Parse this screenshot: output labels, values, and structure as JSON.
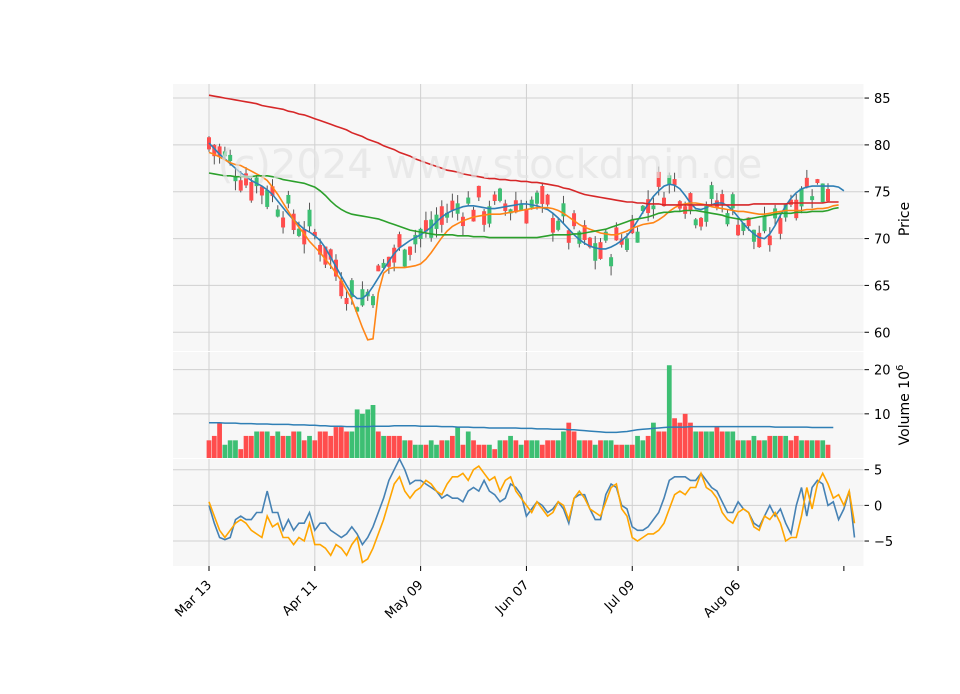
{
  "watermark": "(c)2024 www.stockdmin.de",
  "chart_data": [
    {
      "type": "candlestick",
      "panel": "price",
      "ylabel": "Price",
      "ylim": [
        58,
        86.5
      ],
      "yticks": [
        60,
        65,
        70,
        75,
        80,
        85
      ],
      "xtick_labels": [
        "Mar 13",
        "Apr 11",
        "May 09",
        "Jun 07",
        "Jul 09",
        "Aug 06"
      ],
      "xtick_index": [
        0,
        20,
        40,
        60,
        80,
        100
      ],
      "grid": true,
      "colors": {
        "up": "#3dbf73",
        "down": "#ff4d4d",
        "ma_blue": "#2f7fb5",
        "ma_orange": "#ff8516",
        "ma_green": "#2ca02c",
        "ma_red": "#d62728"
      },
      "moving_averages": [
        {
          "color": "ma_blue",
          "values": [
            80.2,
            79.6,
            79.0,
            78.5,
            78.0,
            77.5,
            77.0,
            76.6,
            76.2,
            75.9,
            75.6,
            75.2,
            74.7,
            74.0,
            73.3,
            72.6,
            72.0,
            71.5,
            71.0,
            70.7,
            70.3,
            69.8,
            69.0,
            68.0,
            67.0,
            66.0,
            65.0,
            64.1,
            63.6,
            63.6,
            64.1,
            64.9,
            65.8,
            66.7,
            67.6,
            68.4,
            69.0,
            69.4,
            69.8,
            70.1,
            70.4,
            70.8,
            71.2,
            71.8,
            72.3,
            72.7,
            73.0,
            73.2,
            73.4,
            73.5,
            73.5,
            73.4,
            73.3,
            73.2,
            73.2,
            73.3,
            73.4,
            73.5,
            73.6,
            73.7,
            73.7,
            73.6,
            73.5,
            73.3,
            73.1,
            72.7,
            72.2,
            71.6,
            71.0,
            70.4,
            69.9,
            69.5,
            69.2,
            69.0,
            68.9,
            68.9,
            69.1,
            69.4,
            69.8,
            70.3,
            71.0,
            71.9,
            72.8,
            73.7,
            74.5,
            75.1,
            75.6,
            75.8,
            75.7,
            75.3,
            74.6,
            73.8,
            73.2,
            73.1,
            73.3,
            73.6,
            73.8,
            73.8,
            73.5,
            73.0,
            72.3,
            71.6,
            71.0,
            70.5,
            70.1,
            70.0,
            70.5,
            71.4,
            72.5,
            73.5,
            74.3,
            74.9,
            75.3,
            75.5,
            75.6,
            75.6,
            75.6,
            75.6,
            75.6,
            75.5,
            75.1
          ]
        },
        {
          "color": "ma_orange",
          "values": [
            79.2,
            79.0,
            78.7,
            78.4,
            78.1,
            77.9,
            77.8,
            77.5,
            77.2,
            76.9,
            76.6,
            76.2,
            75.5,
            74.7,
            73.8,
            72.9,
            72.0,
            71.2,
            70.5,
            69.7,
            69.1,
            68.5,
            67.8,
            67.1,
            66.3,
            65.5,
            64.5,
            63.5,
            62.0,
            60.5,
            59.2,
            59.3,
            64.2,
            66.3,
            66.8,
            66.9,
            66.9,
            66.9,
            67.0,
            67.1,
            67.3,
            67.8,
            68.5,
            69.3,
            70.1,
            70.8,
            71.3,
            71.6,
            71.9,
            72.1,
            72.3,
            72.4,
            72.5,
            72.6,
            72.6,
            72.6,
            72.7,
            72.8,
            72.9,
            73.0,
            73.1,
            73.2,
            73.3,
            73.3,
            73.3,
            73.2,
            73.0,
            72.7,
            72.3,
            71.9,
            71.5,
            71.2,
            71.0,
            70.8,
            70.6,
            70.5,
            70.4,
            70.4,
            70.6,
            70.8,
            71.1,
            71.3,
            71.5,
            71.6,
            71.7,
            72.0,
            72.4,
            72.9,
            73.3,
            73.6,
            73.7,
            73.8,
            73.8,
            73.7,
            73.6,
            73.4,
            73.3,
            73.2,
            73.1,
            73.0,
            72.9,
            72.9,
            72.8,
            72.7,
            72.6,
            72.6,
            72.7,
            72.8,
            72.9,
            73.0,
            73.0,
            73.0,
            73.0,
            73.1,
            73.1,
            73.2,
            73.2,
            73.3,
            73.5,
            73.6
          ]
        },
        {
          "color": "ma_green",
          "values": [
            77.0,
            76.9,
            76.8,
            76.7,
            76.7,
            76.6,
            76.6,
            76.6,
            76.6,
            76.7,
            76.7,
            76.7,
            76.6,
            76.5,
            76.3,
            76.2,
            76.1,
            76.0,
            75.9,
            75.7,
            75.5,
            75.1,
            74.6,
            74.0,
            73.5,
            73.1,
            72.8,
            72.6,
            72.5,
            72.4,
            72.3,
            72.2,
            72.1,
            71.9,
            71.7,
            71.5,
            71.3,
            71.1,
            70.9,
            70.8,
            70.7,
            70.6,
            70.5,
            70.4,
            70.4,
            70.4,
            70.4,
            70.3,
            70.3,
            70.3,
            70.2,
            70.2,
            70.2,
            70.1,
            70.1,
            70.1,
            70.1,
            70.1,
            70.1,
            70.1,
            70.1,
            70.1,
            70.1,
            70.2,
            70.3,
            70.4,
            70.4,
            70.4,
            70.4,
            70.5,
            70.5,
            70.6,
            70.7,
            70.8,
            70.9,
            71.0,
            71.2,
            71.4,
            71.6,
            71.8,
            72.0,
            72.1,
            72.2,
            72.3,
            72.5,
            72.7,
            72.8,
            72.8,
            72.9,
            72.9,
            73.0,
            73.0,
            73.0,
            72.9,
            72.8,
            72.7,
            72.6,
            72.5,
            72.3,
            72.2,
            72.1,
            72.0,
            72.1,
            72.2,
            72.3,
            72.4,
            72.5,
            72.6,
            72.7,
            72.7,
            72.7,
            72.8,
            72.8,
            72.8,
            72.9,
            72.9,
            72.9,
            73.0,
            73.2,
            73.3
          ]
        },
        {
          "color": "ma_red",
          "values": [
            85.3,
            85.2,
            85.1,
            85.0,
            84.9,
            84.8,
            84.7,
            84.6,
            84.5,
            84.4,
            84.2,
            84.1,
            84.0,
            83.9,
            83.8,
            83.6,
            83.5,
            83.3,
            83.2,
            83.0,
            82.8,
            82.6,
            82.4,
            82.2,
            82.0,
            81.8,
            81.6,
            81.3,
            81.1,
            80.9,
            80.6,
            80.4,
            80.2,
            79.9,
            79.7,
            79.5,
            79.2,
            79.0,
            78.8,
            78.5,
            78.3,
            78.1,
            77.9,
            77.7,
            77.5,
            77.3,
            77.2,
            77.1,
            76.9,
            76.8,
            76.7,
            76.6,
            76.5,
            76.4,
            76.4,
            76.3,
            76.3,
            76.2,
            76.2,
            76.1,
            76.1,
            76.0,
            76.0,
            75.9,
            75.8,
            75.7,
            75.6,
            75.4,
            75.3,
            75.1,
            74.9,
            74.7,
            74.6,
            74.5,
            74.4,
            74.3,
            74.2,
            74.1,
            74.0,
            73.9,
            73.9,
            73.8,
            73.8,
            73.7,
            73.7,
            73.7,
            73.6,
            73.6,
            73.6,
            73.6,
            73.6,
            73.6,
            73.6,
            73.6,
            73.6,
            73.6,
            73.6,
            73.6,
            73.6,
            73.6,
            73.6,
            73.6,
            73.6,
            73.7,
            73.7,
            73.7,
            73.7,
            73.7,
            73.7,
            73.7,
            73.8,
            73.8,
            73.8,
            73.8,
            73.8,
            73.8,
            73.8,
            73.9,
            73.9,
            73.9
          ]
        }
      ]
    },
    {
      "type": "bar",
      "panel": "volume",
      "ylabel": "Volume  10^6",
      "ylim": [
        0,
        24
      ],
      "yticks": [
        10,
        20
      ],
      "values": [
        4,
        5,
        8,
        3,
        4,
        4,
        2,
        5,
        5,
        6,
        6,
        6,
        5,
        6,
        5,
        5,
        6,
        6,
        4,
        5,
        4,
        6,
        6,
        5,
        7,
        7,
        6,
        6,
        11,
        10,
        11,
        12,
        6,
        5,
        5,
        5,
        5,
        4,
        4,
        3,
        3,
        3,
        4,
        3,
        4,
        4,
        5,
        7,
        3,
        6,
        4,
        3,
        3,
        3,
        2,
        4,
        4,
        5,
        4,
        3,
        4,
        4,
        4,
        3,
        4,
        4,
        4,
        6,
        8,
        6,
        4,
        4,
        4,
        3,
        4,
        4,
        4,
        3,
        3,
        3,
        3,
        5,
        4,
        5,
        8,
        6,
        6,
        21,
        9,
        8,
        10,
        8,
        6,
        6,
        6,
        6,
        7,
        6,
        6,
        6,
        4,
        4,
        4,
        5,
        4,
        4,
        5,
        5,
        5,
        5,
        4,
        5,
        4,
        4,
        4,
        4,
        4,
        3
      ],
      "up": [
        0,
        0,
        0,
        1,
        1,
        1,
        0,
        0,
        0,
        1,
        0,
        1,
        0,
        1,
        0,
        1,
        0,
        1,
        0,
        1,
        0,
        0,
        0,
        0,
        0,
        0,
        0,
        1,
        1,
        1,
        1,
        1,
        0,
        1,
        0,
        0,
        0,
        1,
        0,
        1,
        1,
        0,
        1,
        1,
        0,
        1,
        0,
        1,
        0,
        1,
        0,
        0,
        0,
        1,
        0,
        1,
        0,
        1,
        0,
        1,
        0,
        1,
        1,
        0,
        0,
        0,
        1,
        1,
        0,
        0,
        1,
        0,
        0,
        1,
        0,
        1,
        1,
        0,
        0,
        1,
        0,
        1,
        1,
        0,
        1,
        0,
        0,
        1,
        0,
        0,
        0,
        0,
        1,
        0,
        1,
        1,
        0,
        0,
        1,
        1,
        0,
        1,
        0,
        1,
        0,
        1,
        0,
        1,
        0,
        1,
        0,
        0,
        1,
        0,
        1,
        0,
        1,
        0,
        0
      ],
      "avg_line": [
        8.0,
        8.0,
        8.0,
        7.9,
        7.9,
        7.9,
        7.8,
        7.8,
        7.8,
        7.7,
        7.7,
        7.7,
        7.6,
        7.6,
        7.6,
        7.6,
        7.5,
        7.5,
        7.5,
        7.4,
        7.4,
        7.3,
        7.3,
        7.2,
        7.2,
        7.2,
        7.1,
        7.1,
        7.1,
        7.1,
        7.1,
        7.2,
        7.2,
        7.2,
        7.2,
        7.3,
        7.3,
        7.3,
        7.3,
        7.3,
        7.2,
        7.2,
        7.2,
        7.2,
        7.1,
        7.1,
        7.1,
        7.0,
        7.0,
        7.0,
        6.9,
        6.9,
        6.9,
        6.8,
        6.8,
        6.8,
        6.8,
        6.8,
        6.8,
        6.7,
        6.7,
        6.7,
        6.6,
        6.6,
        6.6,
        6.5,
        6.5,
        6.5,
        6.4,
        6.4,
        6.3,
        6.2,
        6.1,
        6.0,
        5.9,
        5.8,
        5.8,
        5.8,
        5.9,
        6.0,
        6.2,
        6.4,
        6.5,
        6.6,
        6.7,
        6.8,
        6.9,
        7.0,
        7.0,
        7.0,
        7.0,
        7.1,
        7.1,
        7.1,
        7.1,
        7.1,
        7.1,
        7.1,
        7.1,
        7.1,
        7.1,
        7.1,
        7.1,
        7.1,
        7.1,
        7.1,
        7.1,
        7.0,
        7.0,
        7.0,
        7.0,
        7.0,
        7.0,
        7.0,
        6.9,
        6.9,
        6.9,
        6.9,
        6.9
      ]
    },
    {
      "type": "line",
      "panel": "oscillator",
      "ylim": [
        -8.5,
        6.5
      ],
      "yticks": [
        -5,
        0,
        5
      ],
      "series": [
        {
          "color": "#4682b4",
          "values": [
            0,
            -2.5,
            -4.5,
            -4.8,
            -4.5,
            -2.0,
            -1.5,
            -2.0,
            -2.0,
            -1.0,
            -1.0,
            2.0,
            -1.0,
            -1.0,
            -3.5,
            -2.0,
            -3.5,
            -2.5,
            -2.5,
            -1.0,
            -3.5,
            -2.5,
            -2.5,
            -3.5,
            -4.0,
            -4.5,
            -4.0,
            -3.0,
            -4.0,
            -5.5,
            -4.5,
            -3.0,
            -1.0,
            1.0,
            3.5,
            5.0,
            6.5,
            5.0,
            3.0,
            3.5,
            3.5,
            3.0,
            2.5,
            2.0,
            1.0,
            1.5,
            1.0,
            1.0,
            0.5,
            2.0,
            2.5,
            2.0,
            3.5,
            2.0,
            1.5,
            0.5,
            1.0,
            3.0,
            2.5,
            1.5,
            -1.5,
            -0.5,
            0.5,
            0.0,
            -1.0,
            -0.5,
            0.5,
            -0.5,
            -2.5,
            1.0,
            1.5,
            1.5,
            -0.5,
            -2.0,
            -2.0,
            1.5,
            3.0,
            2.5,
            0.0,
            -0.5,
            -3.0,
            -3.5,
            -3.5,
            -3.0,
            -2.0,
            -1.0,
            1.0,
            3.5,
            4.0,
            4.0,
            4.0,
            3.5,
            3.5,
            4.5,
            3.5,
            2.5,
            2.0,
            0.5,
            -1.0,
            -1.0,
            0.5,
            -0.5,
            -1.0,
            -2.5,
            -3.0,
            -1.5,
            0.0,
            -1.5,
            -0.5,
            -2.5,
            -4.0,
            0.0,
            2.5,
            -1.5,
            2.5,
            3.5,
            3.0,
            0.0,
            0.5,
            -2.0,
            -0.5,
            2.0,
            -4.5
          ]
        },
        {
          "color": "#ffa500",
          "values": [
            0.5,
            -1.5,
            -3.5,
            -4.5,
            -3.5,
            -2.5,
            -2.0,
            -2.5,
            -3.5,
            -4.0,
            -4.5,
            -1.5,
            -3.0,
            -2.5,
            -4.5,
            -4.5,
            -5.5,
            -4.5,
            -5.0,
            -2.5,
            -5.5,
            -5.5,
            -6.0,
            -7.0,
            -5.5,
            -6.0,
            -7.0,
            -5.5,
            -4.5,
            -8.0,
            -7.5,
            -6.0,
            -4.0,
            -2.0,
            0.5,
            3.0,
            4.0,
            2.0,
            1.0,
            2.0,
            2.5,
            3.5,
            3.0,
            2.0,
            1.5,
            3.0,
            4.0,
            4.0,
            4.5,
            3.5,
            5.0,
            5.5,
            4.5,
            3.5,
            4.0,
            2.0,
            3.5,
            4.0,
            2.0,
            1.0,
            0.0,
            -1.0,
            0.5,
            -0.5,
            -1.5,
            -1.0,
            0.5,
            0.0,
            -2.0,
            1.0,
            2.0,
            1.0,
            -0.5,
            -1.0,
            -1.5,
            0.5,
            2.5,
            3.0,
            -0.5,
            -1.5,
            -4.5,
            -5.0,
            -4.5,
            -4.0,
            -4.0,
            -3.5,
            -2.5,
            -0.5,
            1.5,
            2.0,
            1.5,
            2.5,
            2.5,
            4.5,
            2.5,
            2.0,
            1.0,
            -1.0,
            -2.0,
            -2.5,
            -1.0,
            -0.5,
            -1.0,
            -3.0,
            -3.5,
            -1.5,
            -2.0,
            -1.0,
            -2.5,
            -5.0,
            -4.5,
            -4.5,
            -1.5,
            2.5,
            -0.5,
            3.0,
            4.5,
            3.0,
            1.0,
            1.5,
            0.0,
            2.0,
            -2.5
          ]
        }
      ]
    }
  ]
}
